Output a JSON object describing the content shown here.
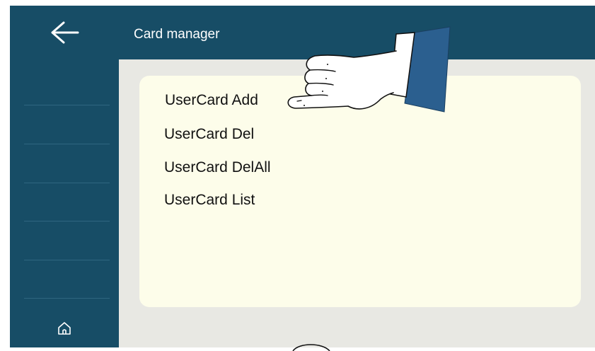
{
  "header": {
    "title": "Card manager",
    "back_icon": "arrow-left-icon"
  },
  "sidebar": {
    "home_icon": "home-icon"
  },
  "menu": {
    "items": [
      {
        "label": "UserCard Add"
      },
      {
        "label": "UserCard Del"
      },
      {
        "label": "UserCard DelAll"
      },
      {
        "label": "UserCard List"
      }
    ]
  },
  "colors": {
    "header_bg": "#174d66",
    "panel_bg": "#fdfdea",
    "content_bg": "#e8e8e3",
    "hand_cuff": "#2b5f8f"
  }
}
